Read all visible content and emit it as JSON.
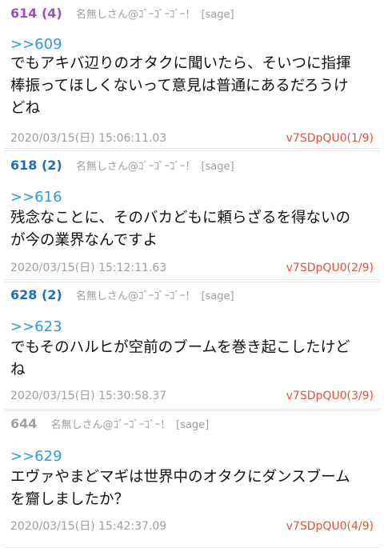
{
  "colors": {
    "num_highlight_purple": "#9c4dcc",
    "num_highlight_blue": "#1f6fb8",
    "num_plain": "#a0a0a0",
    "anchor": "#2d9bd6",
    "uid": "#e0533a",
    "meta": "#9e9e9e"
  },
  "posts": [
    {
      "num": "614 (4)",
      "name": "名無しさん@ｺﾞｰｺﾞｰｺﾞｰ！",
      "mail": "[sage]",
      "anchor": ">>609",
      "lines": [
        "でもアキバ辺りのオタクに聞いたら、そいつに指揮",
        "棒振ってほしくないって意見は普通にあるだろうけ",
        "どね"
      ],
      "date": "2020/03/15(日) 15:06:11.03",
      "uid": "v7SDpQU0(1/9)"
    },
    {
      "num": "618 (2)",
      "name": "名無しさん@ｺﾞｰｺﾞｰｺﾞｰ！",
      "mail": "[sage]",
      "anchor": ">>616",
      "lines": [
        "残念なことに、そのバカどもに頼らざるを得ないの",
        "が今の業界なんですよ"
      ],
      "date": "2020/03/15(日) 15:12:11.63",
      "uid": "v7SDpQU0(2/9)"
    },
    {
      "num": "628 (2)",
      "name": "名無しさん@ｺﾞｰｺﾞｰｺﾞｰ！",
      "mail": "[sage]",
      "anchor": ">>623",
      "lines": [
        "でもそのハルヒが空前のブームを巻き起こしたけど",
        "ね"
      ],
      "date": "2020/03/15(日) 15:30:58.37",
      "uid": "v7SDpQU0(3/9)"
    },
    {
      "num": "644",
      "name": "名無しさん@ｺﾞｰｺﾞｰｺﾞｰ！",
      "mail": "[sage]",
      "anchor": ">>629",
      "lines": [
        "エヴァやまどマギは世界中のオタクにダンスブーム",
        "を齎しましたか？"
      ],
      "date": "2020/03/15(日) 15:42:37.09",
      "uid": "v7SDpQU0(4/9)"
    }
  ]
}
